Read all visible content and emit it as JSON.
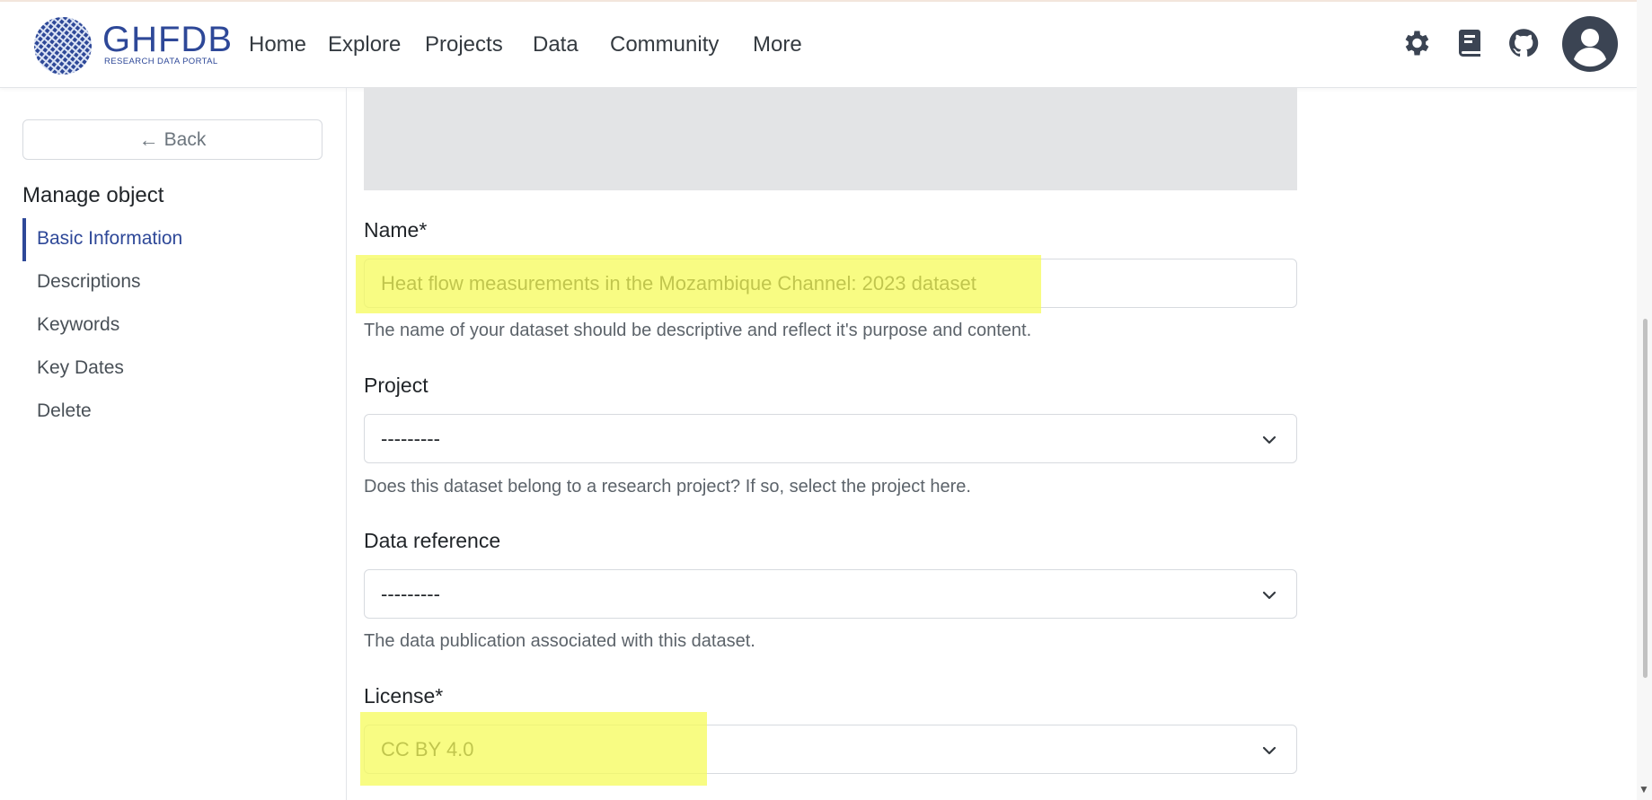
{
  "brand": {
    "name": "GHFDB",
    "subtitle": "RESEARCH DATA PORTAL",
    "color": "#2e4898"
  },
  "nav": {
    "items": [
      {
        "label": "Home"
      },
      {
        "label": "Explore"
      },
      {
        "label": "Projects"
      },
      {
        "label": "Data"
      },
      {
        "label": "Community"
      },
      {
        "label": "More"
      }
    ],
    "icons": [
      "gear-icon",
      "book-icon",
      "github-icon",
      "user-avatar-icon"
    ]
  },
  "sidebar": {
    "back_label": "Back",
    "section_title": "Manage object",
    "items": [
      {
        "label": "Basic Information",
        "active": true
      },
      {
        "label": "Descriptions"
      },
      {
        "label": "Keywords"
      },
      {
        "label": "Key Dates"
      },
      {
        "label": "Delete"
      }
    ]
  },
  "form": {
    "name": {
      "label": "Name*",
      "value": "Heat flow measurements in the Mozambique Channel: 2023 dataset",
      "help": "The name of your dataset should be descriptive and reflect it's purpose and content."
    },
    "project": {
      "label": "Project",
      "value": "---------",
      "help": "Does this dataset belong to a research project? If so, select the project here."
    },
    "data_reference": {
      "label": "Data reference",
      "value": "---------",
      "help": "The data publication associated with this dataset."
    },
    "license": {
      "label": "License*",
      "value": "CC BY 4.0"
    }
  },
  "colors": {
    "highlight": "#f6fb5a",
    "accent": "#2e4898"
  }
}
